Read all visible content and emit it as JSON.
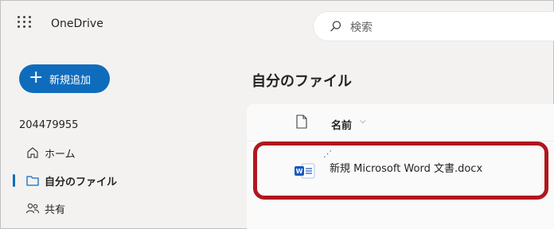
{
  "app": {
    "title": "OneDrive"
  },
  "search": {
    "placeholder": "検索"
  },
  "nav": {
    "new_button_label": "新規追加",
    "account_id": "204479955",
    "items": [
      {
        "label": "ホーム",
        "icon": "home-icon",
        "active": false
      },
      {
        "label": "自分のファイル",
        "icon": "folder-icon",
        "active": true
      },
      {
        "label": "共有",
        "icon": "shared-people-icon",
        "active": false
      }
    ]
  },
  "main": {
    "title": "自分のファイル",
    "columns": {
      "name_header": "名前"
    },
    "files": [
      {
        "name": "新規 Microsoft Word 文書.docx",
        "type_icon": "word-doc-icon",
        "highlighted": true
      }
    ]
  },
  "colors": {
    "accent": "#0f6cbd",
    "highlight_border": "#b0171d",
    "word_blue": "#185abd"
  }
}
